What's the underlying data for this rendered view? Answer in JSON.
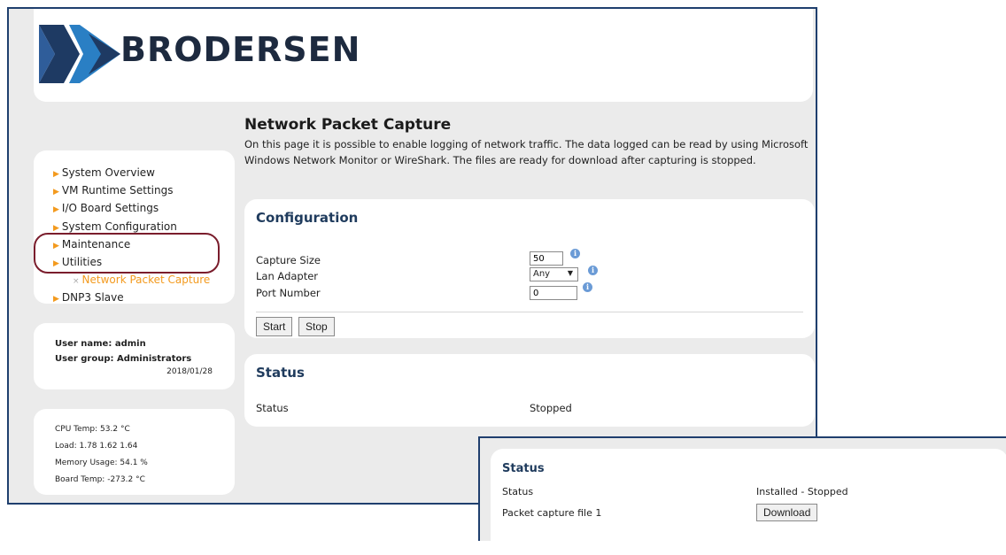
{
  "brand": {
    "name": "BRODERSEN"
  },
  "sidebar": {
    "items": [
      {
        "label": "System Overview"
      },
      {
        "label": "VM Runtime Settings"
      },
      {
        "label": "I/O Board Settings"
      },
      {
        "label": "System Configuration"
      },
      {
        "label": "Maintenance"
      },
      {
        "label": "Utilities"
      },
      {
        "label": "Network Packet Capture"
      },
      {
        "label": "DNP3 Slave"
      }
    ]
  },
  "user": {
    "name_line": "User name: admin",
    "group_line": "User group: Administrators",
    "date": "2018/01/28"
  },
  "system": {
    "cpu_temp": "CPU Temp: 53.2 °C",
    "load": "Load: 1.78  1.62  1.64",
    "memory": "Memory Usage: 54.1 %",
    "board_temp": "Board Temp: -273.2 °C"
  },
  "page": {
    "title": "Network Packet Capture",
    "description": "On this page it is possible to enable logging of network traffic. The data logged can be read by using Microsoft Windows Network Monitor or WireShark. The files are ready for download after capturing is stopped."
  },
  "configuration": {
    "heading": "Configuration",
    "capture_size_label": "Capture Size",
    "capture_size_value": "50",
    "lan_adapter_label": "Lan Adapter",
    "lan_adapter_value": "Any",
    "port_number_label": "Port Number",
    "port_number_value": "0",
    "start_label": "Start",
    "stop_label": "Stop"
  },
  "status": {
    "heading": "Status",
    "status_label": "Status",
    "status_value": "Stopped"
  },
  "inset": {
    "heading": "Status",
    "status_label": "Status",
    "status_value": "Installed - Stopped",
    "file_label": "Packet capture file 1",
    "download_label": "Download"
  },
  "colors": {
    "accent": "#f39a1e",
    "heading_blue": "#1f3b5d",
    "frame_border": "#1f3f6e",
    "highlight": "#7a1d2c",
    "info_icon": "#6b9bd6"
  }
}
